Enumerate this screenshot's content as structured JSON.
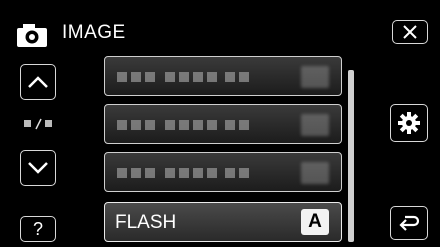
{
  "header": {
    "title": "IMAGE",
    "icon": "camera-icon"
  },
  "window_controls": {
    "close_icon": "close-icon"
  },
  "nav": {
    "up_icon": "chevron-up-icon",
    "down_icon": "chevron-down-icon",
    "page_indicator_icon": "page-indicator-icon",
    "help_label": "?"
  },
  "menu": {
    "items": [
      {
        "label": "",
        "value": ""
      },
      {
        "label": "",
        "value": ""
      },
      {
        "label": "",
        "value": ""
      },
      {
        "label": "FLASH",
        "value": "A"
      }
    ]
  },
  "side": {
    "settings_icon": "gear-icon",
    "back_icon": "return-icon"
  },
  "colors": {
    "background": "#000000",
    "border": "#d8d8d8",
    "text": "#ffffff"
  }
}
